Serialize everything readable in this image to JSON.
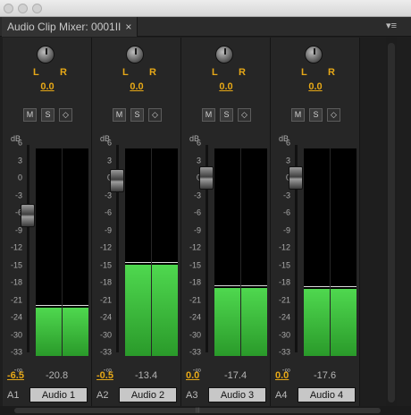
{
  "panel": {
    "tab_label": "Audio Clip Mixer: 0001II",
    "close_glyph": "×",
    "menu_glyph": "▾≡"
  },
  "scale": {
    "unit": "dB",
    "ticks": [
      "6",
      "3",
      "0",
      "-3",
      "-6",
      "-9",
      "-12",
      "-15",
      "-18",
      "-21",
      "-24",
      "-30",
      "-33",
      "-∞"
    ]
  },
  "pan_labels": {
    "left": "L",
    "right": "R"
  },
  "buttons": {
    "mute": "M",
    "solo": "S",
    "keyframe": "◇"
  },
  "channels": [
    {
      "track": "A1",
      "clip": "Audio 1",
      "pan": "0.0",
      "volume": "-6.5",
      "peak": "-20.8",
      "fader_db": -6.5,
      "meter_level_db": -20.8
    },
    {
      "track": "A2",
      "clip": "Audio 2",
      "pan": "0.0",
      "volume": "-0.5",
      "peak": "-13.4",
      "fader_db": -0.5,
      "meter_level_db": -13.4
    },
    {
      "track": "A3",
      "clip": "Audio 3",
      "pan": "0.0",
      "volume": "0.0",
      "peak": "-17.4",
      "fader_db": 0.0,
      "meter_level_db": -17.4
    },
    {
      "track": "A4",
      "clip": "Audio 4",
      "pan": "0.0",
      "volume": "0.0",
      "peak": "-17.6",
      "fader_db": 0.0,
      "meter_level_db": -17.6
    }
  ],
  "colors": {
    "accent": "#e6a817",
    "meter": "#4fd84f",
    "panel_bg": "#262626"
  }
}
